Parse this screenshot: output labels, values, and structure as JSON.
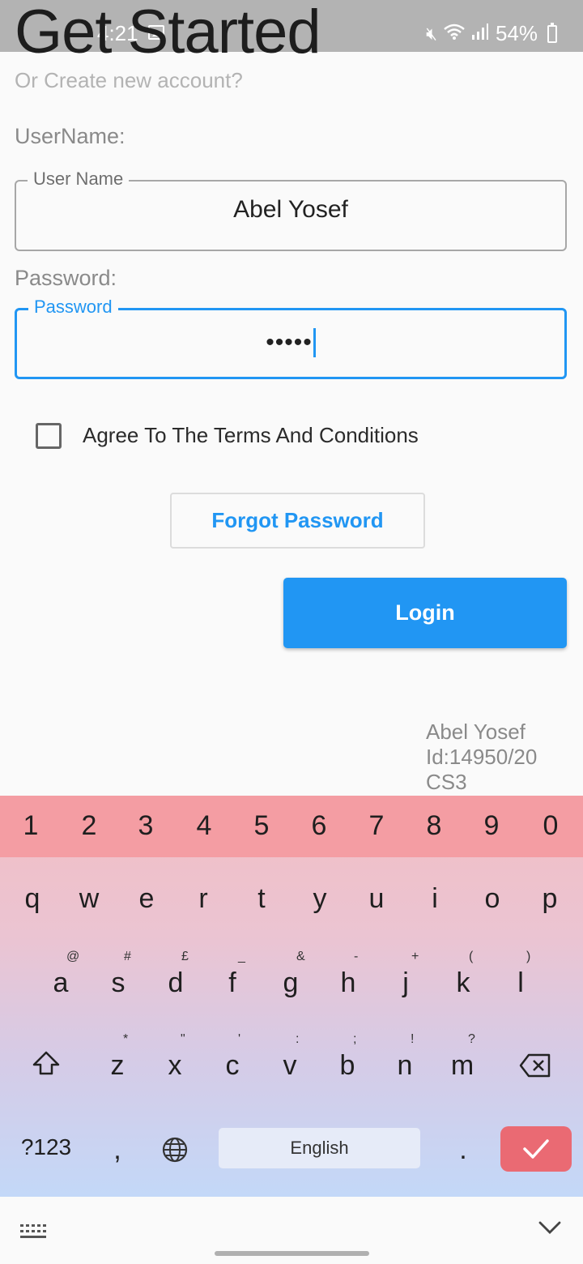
{
  "status_bar": {
    "time": "4:21",
    "battery": "54%",
    "icons": [
      "image-icon",
      "mute-icon",
      "wifi-icon",
      "signal-icon",
      "battery-icon"
    ]
  },
  "header": {
    "title": "Get Started",
    "subtitle": "Or Create new account?"
  },
  "form": {
    "username_label": "UserName:",
    "username_legend": "User Name",
    "username_value": "Abel Yosef",
    "password_label": "Password:",
    "password_legend": "Password",
    "password_value": "•••••",
    "terms_label": "Agree To The Terms And Conditions",
    "terms_checked": false,
    "forgot_label": "Forgot Password",
    "login_label": "Login"
  },
  "credit": {
    "name": "Abel Yosef",
    "id": "Id:14950/20",
    "section": "CS3"
  },
  "colors": {
    "accent": "#2196f3",
    "title": "#1d1d1d",
    "muted": "#8a8a8a",
    "keyboard_numrow": "#f49da3",
    "enter_key": "#ea6a73"
  },
  "keyboard": {
    "numbers": [
      "1",
      "2",
      "3",
      "4",
      "5",
      "6",
      "7",
      "8",
      "9",
      "0"
    ],
    "row1": [
      "q",
      "w",
      "e",
      "r",
      "t",
      "y",
      "u",
      "i",
      "o",
      "p"
    ],
    "row2": [
      {
        "key": "a",
        "alt": "@"
      },
      {
        "key": "s",
        "alt": "#"
      },
      {
        "key": "d",
        "alt": "£"
      },
      {
        "key": "f",
        "alt": "_"
      },
      {
        "key": "g",
        "alt": "&"
      },
      {
        "key": "h",
        "alt": "-"
      },
      {
        "key": "j",
        "alt": "+"
      },
      {
        "key": "k",
        "alt": "("
      },
      {
        "key": "l",
        "alt": ")"
      }
    ],
    "row3": [
      {
        "key": "z",
        "alt": "*"
      },
      {
        "key": "x",
        "alt": "\""
      },
      {
        "key": "c",
        "alt": "'"
      },
      {
        "key": "v",
        "alt": ":"
      },
      {
        "key": "b",
        "alt": ";"
      },
      {
        "key": "n",
        "alt": "!"
      },
      {
        "key": "m",
        "alt": "?"
      }
    ],
    "symbols_label": "?123",
    "comma": ",",
    "space_label": "English",
    "period": "."
  }
}
